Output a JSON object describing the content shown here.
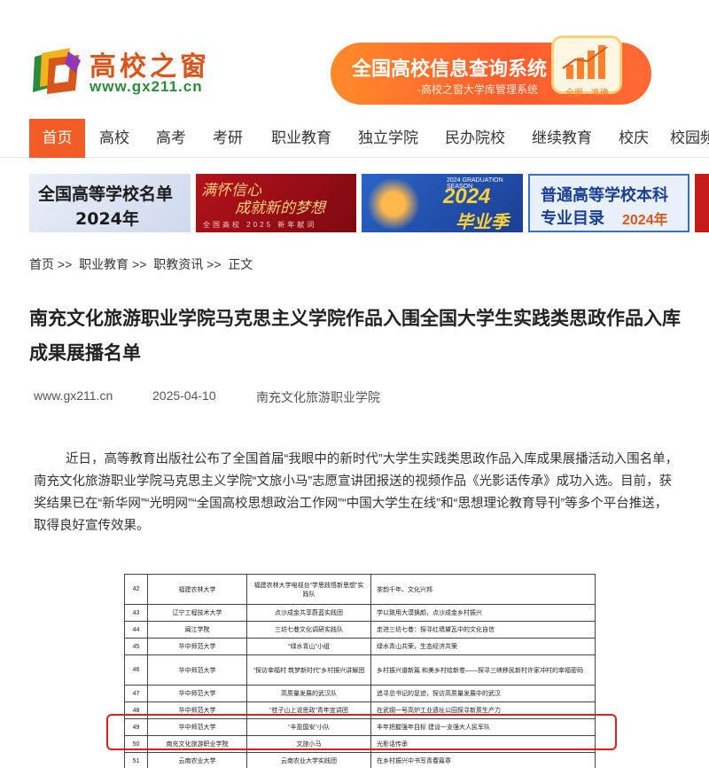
{
  "header": {
    "logo_name": "高校之窗",
    "logo_url": "www.gx211.cn",
    "banner_title": "全国高校信息查询系统",
    "banner_sub": "-高校之窗大学库管理系统",
    "banner_badge": "全面 · 准确"
  },
  "nav": {
    "items": [
      "首页",
      "高校",
      "高考",
      "考研",
      "职业教育",
      "独立学院",
      "民办院校",
      "继续教育",
      "校庆",
      "校园频"
    ]
  },
  "promos": {
    "tile1_line1": "全国高等学校名单",
    "tile1_line2": "2024年",
    "tile2_line1": "满怀信心",
    "tile2_line2": "成就新的梦想",
    "tile2_line3": "全国高校 2025 新年献词",
    "tile3_small": "2024 GRADUATION SEASON",
    "tile3_big": "2024",
    "tile3_word": "毕业季",
    "tile4_line1": "普通高等学校本科",
    "tile4_line2": "专业目录",
    "tile4_year": "2024年"
  },
  "breadcrumb": [
    "首页",
    ">>",
    "职业教育",
    ">>",
    "职教资讯",
    ">>",
    "正文"
  ],
  "article": {
    "title": "南充文化旅游职业学院马克思主义学院作品入围全国大学生实践类思政作品入库成果展播名单",
    "source": "www.gx211.cn",
    "date": "2025-04-10",
    "author": "南充文化旅游职业学院",
    "paragraph": "近日，高等教育出版社公布了全国首届“我眼中的新时代”大学生实践类思政作品入库成果展播活动入围名单，南充文化旅游职业学院马克思主义学院“文旅小马”志愿宣讲团报送的视频作品《光影话传承》成功入选。目前，获奖结果已在“新华网”“光明网”“全国高校思想政治工作网”“中国大学生在线”和“思想理论教育导刊”等多个平台推送，取得良好宣传效果。"
  },
  "table": {
    "rows": [
      {
        "no": "42",
        "school": "福建农林大学",
        "team": "福建农林大学电视台“学思践悟新思想”实践队",
        "work": "茶韵千年、文化兴邦"
      },
      {
        "no": "43",
        "school": "辽宁工程技术大学",
        "team": "点沙成金共享蔚蓝实践团",
        "work": "学以致用大漠换颜，点沙成金乡村振兴"
      },
      {
        "no": "44",
        "school": "闽江学院",
        "team": "三坊七巷文化调研实践队",
        "work": "走进三坊七巷：探寻红墙黛瓦中的文化自信"
      },
      {
        "no": "45",
        "school": "华中师范大学",
        "team": "“绿水青山”小组",
        "work": "绿水青山共荣，生态经济共荣"
      },
      {
        "no": "46",
        "school": "华中师范大学",
        "team": "“探访幸福村 筑梦新时代”乡村振兴讲解团",
        "work": "乡村振兴谱新篇 和美乡村绘新卷——探寻三峡移民新村许家冲村的幸福密码"
      },
      {
        "no": "47",
        "school": "华中师范大学",
        "team": "高质量发展的武汉队",
        "work": "追寻总书记的足迹，探访高质量发展中的武汉"
      },
      {
        "no": "48",
        "school": "华中师范大学",
        "team": "“桂子山上说思政”青年宣讲团",
        "work": "在武钢一号高炉工业遗址公园探寻新质生产力"
      },
      {
        "no": "49",
        "school": "华中师范大学",
        "team": "“丰盈国安”小队",
        "work": "丰年把握强年目标 建设一支强大人民军队"
      },
      {
        "no": "50",
        "school": "南充文化旅游职业学院",
        "team": "文旅小马",
        "work": "光影话传承"
      },
      {
        "no": "51",
        "school": "云南农业大学",
        "team": "云南农业大学实践团",
        "work": "在乡村振兴中书写青春篇章"
      }
    ]
  }
}
